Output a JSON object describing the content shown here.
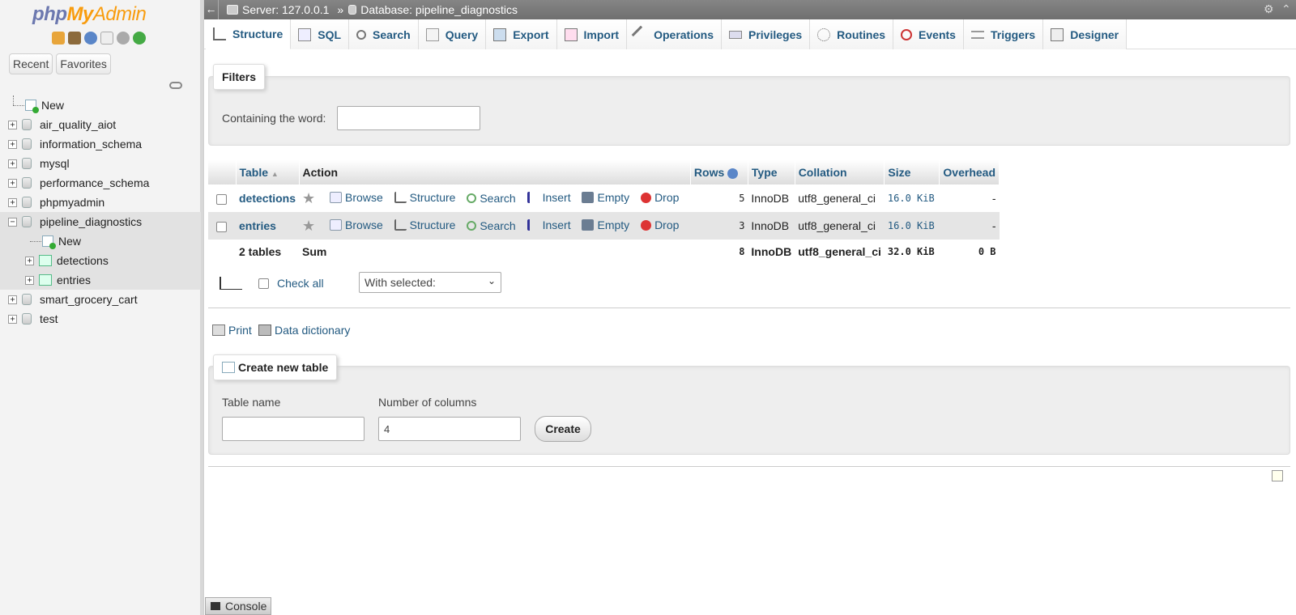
{
  "logo": {
    "php": "php",
    "my": "My",
    "admin": "Admin"
  },
  "nav": {
    "recent": "Recent",
    "favorites": "Favorites",
    "tree": [
      {
        "label": "New",
        "type": "new",
        "level": 0
      },
      {
        "label": "air_quality_aiot",
        "type": "db",
        "level": 0
      },
      {
        "label": "information_schema",
        "type": "db",
        "level": 0
      },
      {
        "label": "mysql",
        "type": "db",
        "level": 0
      },
      {
        "label": "performance_schema",
        "type": "db",
        "level": 0
      },
      {
        "label": "phpmyadmin",
        "type": "db",
        "level": 0
      },
      {
        "label": "pipeline_diagnostics",
        "type": "db",
        "level": 0,
        "expanded": true
      },
      {
        "label": "New",
        "type": "new",
        "level": 1
      },
      {
        "label": "detections",
        "type": "table",
        "level": 1
      },
      {
        "label": "entries",
        "type": "table",
        "level": 1
      },
      {
        "label": "smart_grocery_cart",
        "type": "db",
        "level": 0
      },
      {
        "label": "test",
        "type": "db",
        "level": 0
      }
    ]
  },
  "breadcrumb": {
    "server": "Server: 127.0.0.1",
    "separator": "»",
    "database": "Database: pipeline_diagnostics"
  },
  "tabs": [
    "Structure",
    "SQL",
    "Search",
    "Query",
    "Export",
    "Import",
    "Operations",
    "Privileges",
    "Routines",
    "Events",
    "Triggers",
    "Designer"
  ],
  "filters": {
    "legend": "Filters",
    "label": "Containing the word:",
    "value": ""
  },
  "table": {
    "headers": {
      "table": "Table",
      "sort_indicator": "▲",
      "action": "Action",
      "rows": "Rows",
      "type": "Type",
      "collation": "Collation",
      "size": "Size",
      "overhead": "Overhead"
    },
    "actions": [
      "Browse",
      "Structure",
      "Search",
      "Insert",
      "Empty",
      "Drop"
    ],
    "rows": [
      {
        "name": "detections",
        "rows": "5",
        "type": "InnoDB",
        "collation": "utf8_general_ci",
        "size": "16.0 KiB",
        "overhead": "-"
      },
      {
        "name": "entries",
        "rows": "3",
        "type": "InnoDB",
        "collation": "utf8_general_ci",
        "size": "16.0 KiB",
        "overhead": "-"
      }
    ],
    "footer": {
      "count": "2 tables",
      "sum": "Sum",
      "rows": "8",
      "type": "InnoDB",
      "collation": "utf8_general_ci",
      "size": "32.0 KiB",
      "overhead": "0 B"
    }
  },
  "bulk": {
    "check_all": "Check all",
    "with_selected": "With selected:"
  },
  "links": {
    "print": "Print",
    "data_dictionary": "Data dictionary"
  },
  "create": {
    "legend": "Create new table",
    "table_name_label": "Table name",
    "table_name_value": "",
    "columns_label": "Number of columns",
    "columns_value": "4",
    "button": "Create"
  },
  "console": "Console"
}
